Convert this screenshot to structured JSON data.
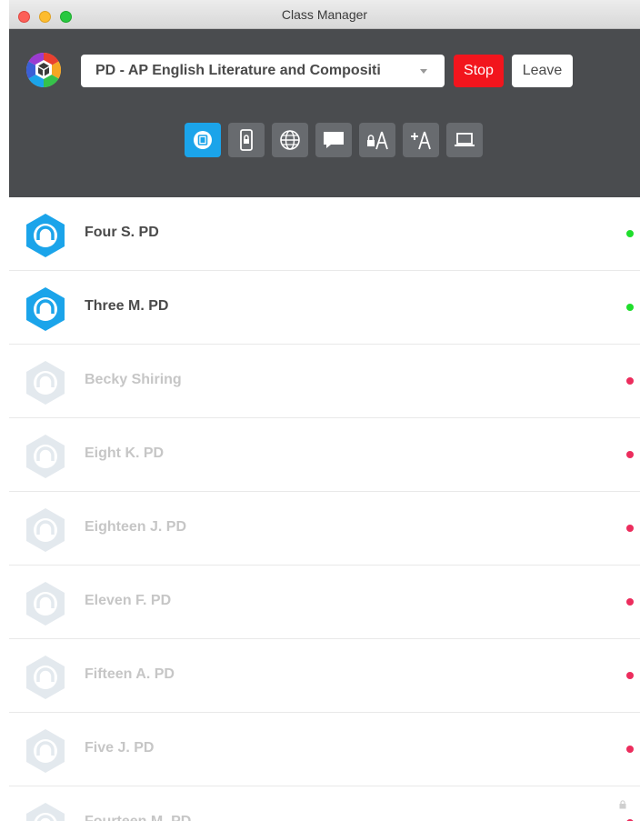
{
  "window": {
    "title": "Class Manager",
    "controls": [
      "close",
      "minimize",
      "zoom"
    ]
  },
  "header": {
    "class_select": {
      "selected": "PD - AP English Literature and Compositi"
    },
    "stop_label": "Stop",
    "leave_label": "Leave",
    "toolbar": [
      {
        "icon": "screen-view-icon",
        "active": true
      },
      {
        "icon": "lock-device-icon",
        "active": false
      },
      {
        "icon": "web-icon",
        "active": false
      },
      {
        "icon": "message-icon",
        "active": false
      },
      {
        "icon": "lock-apps-icon",
        "active": false
      },
      {
        "icon": "open-app-icon",
        "active": false
      },
      {
        "icon": "laptop-icon",
        "active": false
      }
    ]
  },
  "students": [
    {
      "name": "Four S. PD",
      "status": "online"
    },
    {
      "name": "Three M. PD",
      "status": "online"
    },
    {
      "name": "Becky Shiring",
      "status": "offline"
    },
    {
      "name": "Eight K. PD",
      "status": "offline"
    },
    {
      "name": "Eighteen J. PD",
      "status": "offline"
    },
    {
      "name": "Eleven F. PD",
      "status": "offline"
    },
    {
      "name": "Fifteen A. PD",
      "status": "offline"
    },
    {
      "name": "Five J. PD",
      "status": "offline"
    },
    {
      "name": "Fourteen M. PD",
      "status": "offline",
      "locked": true
    }
  ],
  "colors": {
    "header_bg": "#4a4c4f",
    "accent": "#1ba4ea",
    "stop": "#f2151d",
    "online": "#1fde2c",
    "offline": "#ec2d5d"
  }
}
